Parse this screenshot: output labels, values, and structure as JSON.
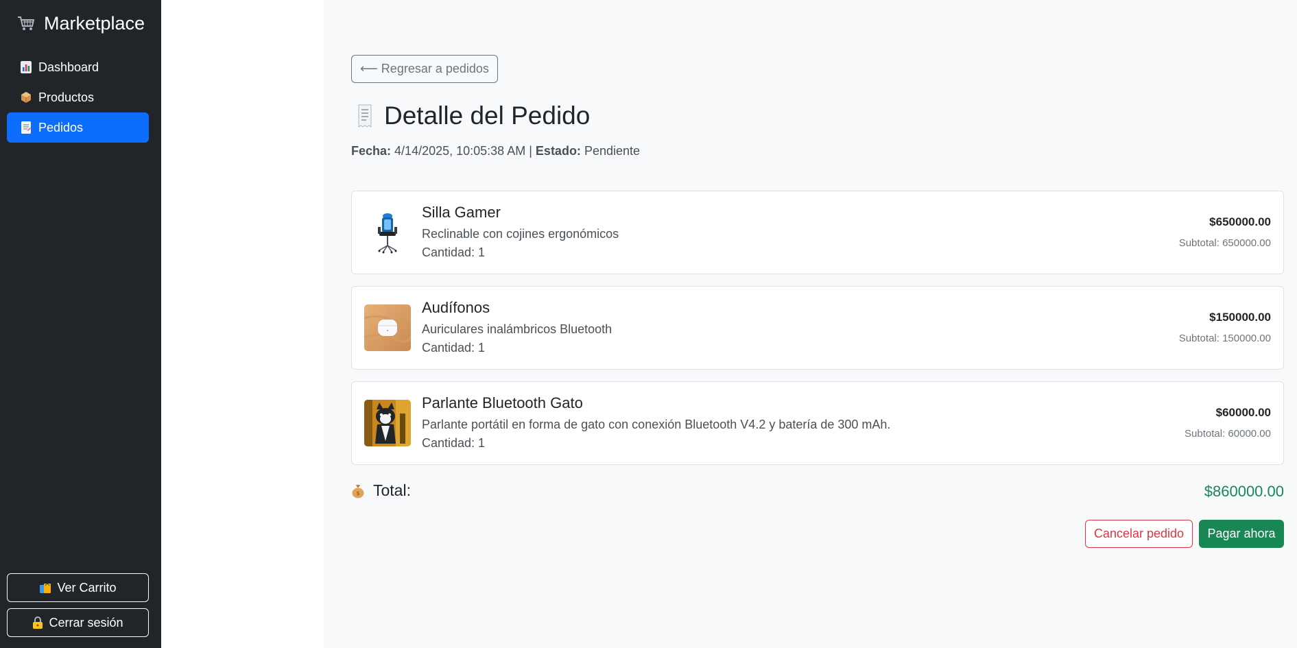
{
  "sidebar": {
    "brand": "Marketplace",
    "brand_icon": "cart-icon",
    "items": [
      {
        "label": "Dashboard",
        "icon": "chart-icon",
        "active": false
      },
      {
        "label": "Productos",
        "icon": "package-icon",
        "active": false
      },
      {
        "label": "Pedidos",
        "icon": "document-icon",
        "active": true
      }
    ],
    "cart_label": "Ver Carrito",
    "logout_label": "Cerrar sesión"
  },
  "main": {
    "back_label": "⟵ Regresar a pedidos",
    "title": "Detalle del Pedido",
    "title_icon": "receipt-icon",
    "meta": {
      "date_label": "Fecha:",
      "date_value": "4/14/2025, 10:05:38 AM",
      "separator": "|",
      "status_label": "Estado:",
      "status_value": "Pendiente"
    },
    "items": [
      {
        "name": "Silla Gamer",
        "description": "Reclinable con cojines ergonómicos",
        "quantity": "Cantidad: 1",
        "price": "$650000.00",
        "subtotal": "Subtotal: 650000.00",
        "image": "gaming-chair-image"
      },
      {
        "name": "Audífonos",
        "description": "Auriculares inalámbricos Bluetooth",
        "quantity": "Cantidad: 1",
        "price": "$150000.00",
        "subtotal": "Subtotal: 150000.00",
        "image": "earbuds-image"
      },
      {
        "name": "Parlante Bluetooth Gato",
        "description": "Parlante portátil en forma de gato con conexión Bluetooth V4.2 y batería de 300 mAh.",
        "quantity": "Cantidad: 1",
        "price": "$60000.00",
        "subtotal": "Subtotal: 60000.00",
        "image": "cat-speaker-image"
      }
    ],
    "total_label": "Total:",
    "total_icon": "money-bag-icon",
    "total_value": "$860000.00",
    "cancel_label": "Cancelar pedido",
    "pay_label": "Pagar ahora"
  },
  "colors": {
    "sidebar_bg": "#212529",
    "active_nav": "#0d6efd",
    "success": "#198754",
    "danger": "#dc3545",
    "main_bg": "#f8f9fa"
  }
}
